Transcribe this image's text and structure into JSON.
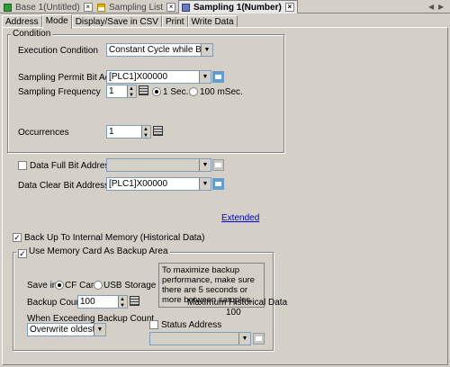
{
  "doc_tabs": [
    {
      "label": "Base 1(Untitled)",
      "icon": "screen-icon",
      "active": false
    },
    {
      "label": "Sampling List",
      "icon": "table-icon",
      "active": false
    },
    {
      "label": "Sampling 1(Number)",
      "icon": "sampling-icon",
      "active": true
    }
  ],
  "sub_tabs": [
    "Address",
    "Mode",
    "Display/Save in CSV",
    "Print",
    "Write Data"
  ],
  "condition": {
    "group_title": "Condition",
    "exec_label": "Execution Condition",
    "exec_value": "Constant Cycle while Bit is ON",
    "permit_label": "Sampling Permit Bit Address",
    "permit_value": "[PLC1]X00000",
    "freq_label": "Sampling Frequency",
    "freq_value": "1",
    "freq_opt1": "1 Sec.",
    "freq_opt2": "100 mSec.",
    "occ_label": "Occurrences",
    "occ_value": "1"
  },
  "data_full": {
    "label": "Data Full Bit Address",
    "value": ""
  },
  "data_clear": {
    "label": "Data Clear Bit Address",
    "value": "[PLC1]X00000"
  },
  "extended_link": "Extended",
  "backup": {
    "label": "Back Up To Internal Memory (Historical Data)",
    "memcard_label": "Use Memory Card As Backup Area",
    "save_in_label": "Save in",
    "save_opt1": "CF Card",
    "save_opt2": "USB Storage",
    "count_label": "Backup Count",
    "count_value": "100",
    "exceed_label": "When Exceeding Backup Count",
    "exceed_value": "Overwrite oldest data",
    "hint": "To maximize backup performance, make sure there are 5 seconds or more between samples.",
    "max_label": "Maximum Historical Data",
    "max_value": "100",
    "status_label": "Status Address",
    "status_value": ""
  }
}
